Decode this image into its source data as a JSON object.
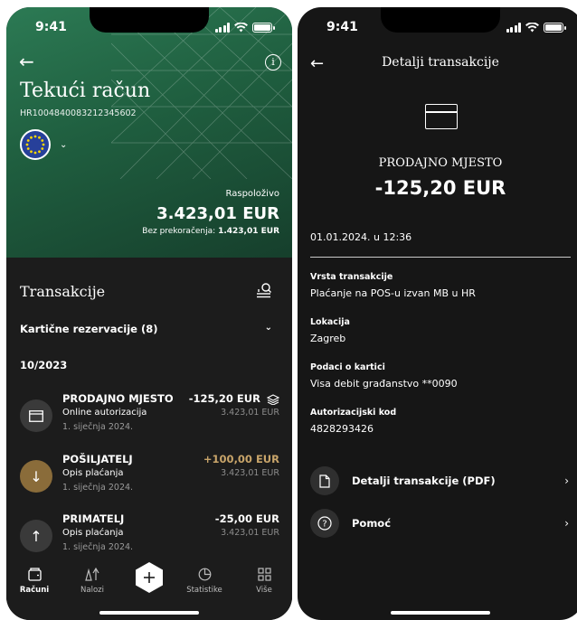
{
  "status_time": "9:41",
  "left": {
    "account_title": "Tekući račun",
    "iban": "HR1004840083212345602",
    "available_label": "Raspoloživo",
    "balance": "3.423,01 EUR",
    "overdraft_label": "Bez prekoračenja:",
    "overdraft_value": "1.423,01 EUR",
    "section_title": "Transakcije",
    "card_reservations": "Kartične rezervacije (8)",
    "month": "10/2023",
    "transactions": [
      {
        "name": "PRODAJNO MJESTO",
        "desc": "Online autorizacija",
        "date": "1. siječnja 2024.",
        "amount": "-125,20 EUR",
        "balance": "3.423,01 EUR",
        "icon": "card-icon"
      },
      {
        "name": "POŠILJATELJ",
        "desc": "Opis plaćanja",
        "date": "1. siječnja 2024.",
        "amount": "+100,00 EUR",
        "balance": "3.423,01 EUR",
        "icon": "arrow-down-icon"
      },
      {
        "name": "PRIMATELJ",
        "desc": "Opis plaćanja",
        "date": "1. siječnja 2024.",
        "amount": "-25,00 EUR",
        "balance": "3.423,01 EUR",
        "icon": "arrow-up-icon"
      }
    ],
    "tabs": [
      {
        "label": "Računi",
        "icon": "wallet-icon",
        "active": true
      },
      {
        "label": "Nalozi",
        "icon": "transfer-icon"
      },
      {
        "label": "Statistike",
        "icon": "pie-chart-icon"
      },
      {
        "label": "Više",
        "icon": "grid-icon"
      }
    ]
  },
  "right": {
    "title": "Detalji transakcije",
    "merchant": "PRODAJNO MJESTO",
    "amount": "-125,20 EUR",
    "date": "01.01.2024. u 12:36",
    "details": [
      {
        "label": "Vrsta transakcije",
        "value": "Plaćanje na POS-u izvan MB u HR"
      },
      {
        "label": "Lokacija",
        "value": "Zagreb"
      },
      {
        "label": "Podaci o kartici",
        "value": "Visa debit građanstvo **0090"
      },
      {
        "label": "Autorizacijski kod",
        "value": "4828293426"
      }
    ],
    "actions": [
      {
        "label": "Detalji transakcije (PDF)",
        "icon": "document-icon"
      },
      {
        "label": "Pomoć",
        "icon": "help-icon"
      }
    ]
  },
  "colors": {
    "green": "#1f5e3f",
    "positive": "#c9a56a",
    "dark": "#1b1b1b"
  }
}
